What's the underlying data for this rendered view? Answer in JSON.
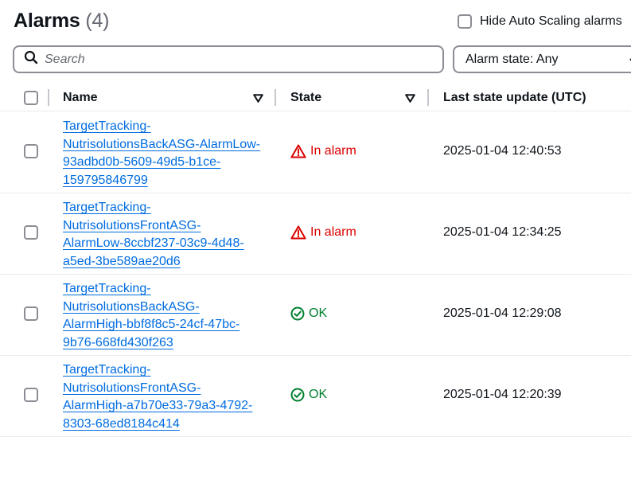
{
  "header": {
    "title": "Alarms",
    "count": "(4)"
  },
  "hide_autoscaling": {
    "label": "Hide Auto Scaling alarms",
    "checked": false
  },
  "search": {
    "placeholder": "Search",
    "icon": "search-icon"
  },
  "state_filter": {
    "value": "Alarm state: Any",
    "icon": "caret-down-icon"
  },
  "table": {
    "columns": [
      {
        "label": "Name",
        "sortable": true
      },
      {
        "label": "State",
        "sortable": true
      },
      {
        "label": "Last state update (UTC)",
        "sortable": false
      }
    ],
    "rows": [
      {
        "name_lines": [
          "TargetTracking-",
          "NutrisolutionsBackASG-AlarmLow-",
          "93adbd0b-5609-49d5-b1ce-",
          "159795846799"
        ],
        "state": "In alarm",
        "state_type": "alarm",
        "updated": "2025-01-04 12:40:53"
      },
      {
        "name_lines": [
          "TargetTracking-",
          "NutrisolutionsFrontASG-",
          "AlarmLow-8ccbf237-03c9-4d48-",
          "a5ed-3be589ae20d6"
        ],
        "state": "In alarm",
        "state_type": "alarm",
        "updated": "2025-01-04 12:34:25"
      },
      {
        "name_lines": [
          "TargetTracking-",
          "NutrisolutionsBackASG-",
          "AlarmHigh-bbf8f8c5-24cf-47bc-",
          "9b76-668fd430f263"
        ],
        "state": "OK",
        "state_type": "ok",
        "updated": "2025-01-04 12:29:08"
      },
      {
        "name_lines": [
          "TargetTracking-",
          "NutrisolutionsFrontASG-",
          "AlarmHigh-a7b70e33-79a3-4792-",
          "8303-68ed8184c414"
        ],
        "state": "OK",
        "state_type": "ok",
        "updated": "2025-01-04 12:20:39"
      }
    ]
  },
  "colors": {
    "link": "#006ce0",
    "alarm": "#db0000",
    "ok": "#00802f",
    "text": "#0f141a"
  }
}
